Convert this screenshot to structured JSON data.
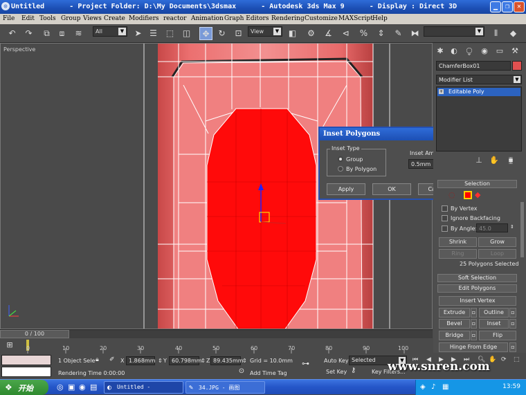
{
  "window": {
    "title": "Untitled      - Project Folder: D:\\My Documents\\3dsmax      - Autodesk 3ds Max 9      - Display : Direct 3D",
    "minimize_icon": "minimize-icon",
    "restore_icon": "restore-icon",
    "close_icon": "close-icon"
  },
  "menu": [
    "File",
    "Edit",
    "Tools",
    "Group",
    "Views",
    "Create",
    "Modifiers",
    "reactor",
    "Animation",
    "Graph Editors",
    "Rendering",
    "Customize",
    "MAXScript",
    "Help"
  ],
  "toolbar": {
    "selection_filter": "All",
    "reference_coord": "View",
    "named_selection": ""
  },
  "viewport": {
    "label": "Perspective"
  },
  "command_panel": {
    "object_name": "ChamferBox01",
    "object_color": "#e05050",
    "modifier_list": "Modifier List",
    "stack_item": "Editable Poly",
    "selection_header": "Selection",
    "by_vertex": "By Vertex",
    "ignore_backfacing": "Ignore Backfacing",
    "by_angle": "By Angle:",
    "by_angle_value": "45.0",
    "shrink": "Shrink",
    "grow": "Grow",
    "ring": "Ring",
    "loop": "Loop",
    "selection_status": "25 Polygons Selected",
    "soft_selection": "Soft Selection",
    "edit_polygons": "Edit Polygons",
    "insert_vertex": "Insert Vertex",
    "extrude": "Extrude",
    "outline": "Outline",
    "bevel": "Bevel",
    "inset": "Inset",
    "bridge": "Bridge",
    "flip": "Flip",
    "hinge_from_edge": "Hinge From Edge"
  },
  "dialog": {
    "title": "Inset Polygons",
    "inset_type_label": "Inset Type",
    "option_group": "Group",
    "option_by_polygon": "By Polygon",
    "inset_amount_label": "Inset Amount",
    "inset_amount_value": "0.5mm",
    "apply": "Apply",
    "ok": "OK",
    "cancel": "Cancel"
  },
  "timeline": {
    "slider_text": "0 / 100",
    "ticks": [
      "0",
      "10",
      "20",
      "30",
      "40",
      "50",
      "60",
      "70",
      "80",
      "90",
      "100"
    ]
  },
  "status": {
    "selection": "1 Object Sele",
    "x_label": "X",
    "x_value": "1.868mm",
    "y_label": "Y",
    "y_value": "60.798mm",
    "z_label": "Z",
    "z_value": "89.435mm",
    "grid": "Grid = 10.0mm",
    "rendering_time": "Rendering Time  0:00:00",
    "add_time_tag": "Add Time Tag",
    "auto_key": "Auto Key",
    "selected": "Selected",
    "set_key": "Set Key",
    "key_filters": "Key Filters..."
  },
  "taskbar": {
    "start": "开始",
    "tasks": [
      "Untitled      -",
      "34.JPG - 画图"
    ],
    "clock": "13:59"
  },
  "watermark": "www.snren.com"
}
